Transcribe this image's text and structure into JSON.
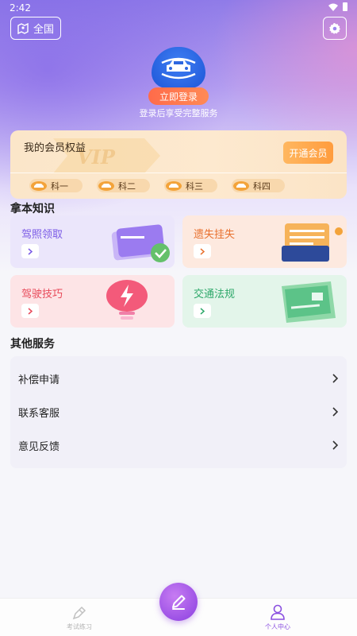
{
  "status": {
    "time": "2:42"
  },
  "header": {
    "region_label": "全国"
  },
  "profile": {
    "login_label": "立即登录",
    "login_hint": "登录后享受完整服务"
  },
  "vip": {
    "title": "我的会员权益",
    "watermark": "VIP",
    "open_label": "开通会员",
    "subjects": [
      {
        "label": "科一"
      },
      {
        "label": "科二"
      },
      {
        "label": "科三"
      },
      {
        "label": "科四"
      }
    ]
  },
  "knowledge": {
    "title": "拿本知识",
    "cards": [
      {
        "label": "驾照领取",
        "color": "#7b5be6",
        "bg": "#ebe6fb",
        "icon": "license-card-icon"
      },
      {
        "label": "遗失挂失",
        "color": "#e8702e",
        "bg": "#fde9df",
        "icon": "document-tablet-icon"
      },
      {
        "label": "驾驶技巧",
        "color": "#e84a5a",
        "bg": "#fde4e6",
        "icon": "lightning-lamp-icon"
      },
      {
        "label": "交通法规",
        "color": "#2ea86a",
        "bg": "#e3f5ea",
        "icon": "regulation-scroll-icon"
      }
    ]
  },
  "other_services": {
    "title": "其他服务",
    "items": [
      {
        "label": "补偿申请"
      },
      {
        "label": "联系客服"
      },
      {
        "label": "意见反馈"
      }
    ]
  },
  "tabbar": {
    "tabs": [
      {
        "label": "考试练习",
        "active": false
      },
      {
        "label": "个人中心",
        "active": true
      }
    ],
    "active_color": "#8a4fe0"
  }
}
